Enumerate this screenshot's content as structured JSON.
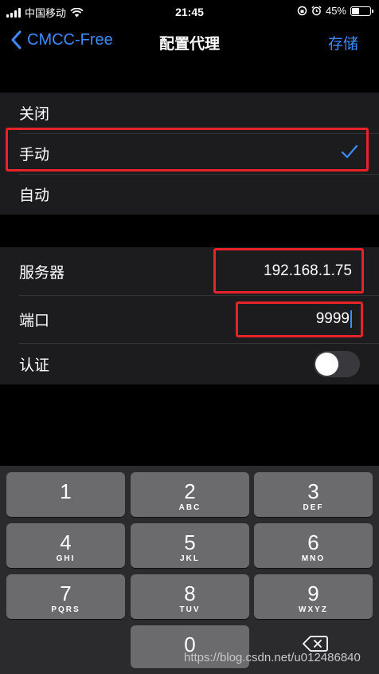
{
  "status_bar": {
    "carrier": "中国移动",
    "time": "21:45",
    "battery_text": "45%",
    "battery_level": 0.45
  },
  "nav": {
    "back_label": "CMCC-Free",
    "title": "配置代理",
    "save_label": "存储"
  },
  "proxy_modes": {
    "options": [
      "关闭",
      "手动",
      "自动"
    ],
    "selected": "手动"
  },
  "settings": {
    "server_label": "服务器",
    "server_value": "192.168.1.75",
    "port_label": "端口",
    "port_value": "9999",
    "auth_label": "认证",
    "auth_enabled": false
  },
  "keypad": {
    "keys": [
      {
        "num": "1",
        "letters": ""
      },
      {
        "num": "2",
        "letters": "ABC"
      },
      {
        "num": "3",
        "letters": "DEF"
      },
      {
        "num": "4",
        "letters": "GHI"
      },
      {
        "num": "5",
        "letters": "JKL"
      },
      {
        "num": "6",
        "letters": "MNO"
      },
      {
        "num": "7",
        "letters": "PQRS"
      },
      {
        "num": "8",
        "letters": "TUV"
      },
      {
        "num": "9",
        "letters": "WXYZ"
      },
      {
        "num": "0",
        "letters": ""
      }
    ]
  },
  "watermark": "https://blog.csdn.net/u012486840",
  "colors": {
    "accent": "#3d8bfd",
    "highlight": "#e8222a"
  }
}
